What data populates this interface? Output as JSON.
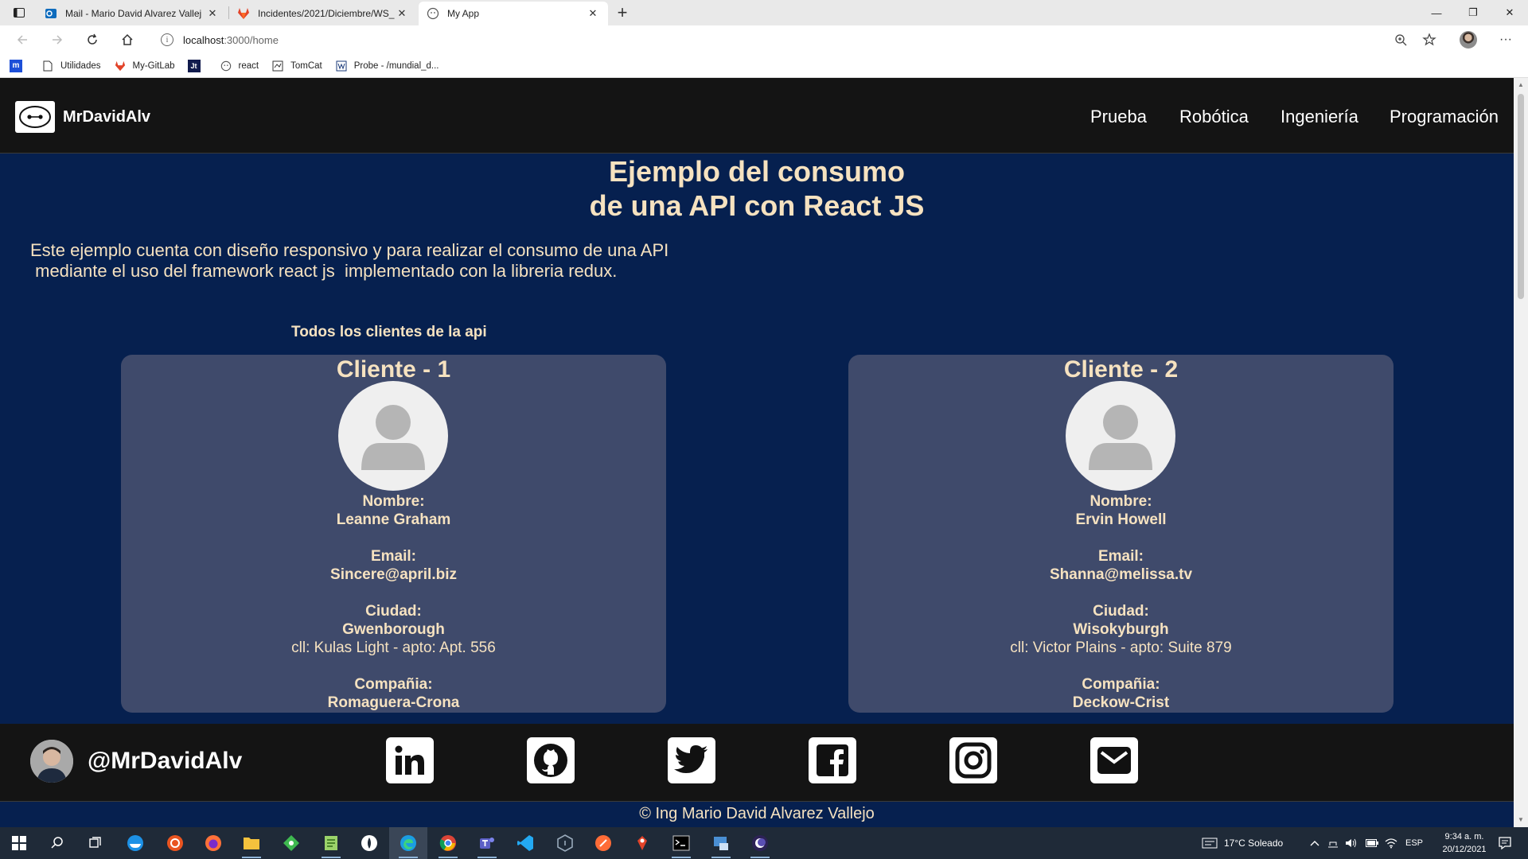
{
  "browser": {
    "tabs": [
      {
        "title": "Mail - Mario David Alvarez Vallej",
        "icon": "outlook-icon",
        "active": false
      },
      {
        "title": "Incidentes/2021/Diciembre/WS_",
        "icon": "gitlab-icon",
        "active": false
      },
      {
        "title": "My App",
        "icon": "react-face-icon",
        "active": true
      }
    ],
    "url_host": "localhost",
    "url_path": ":3000/home",
    "bookmarks": [
      {
        "label": "",
        "icon": "m-icon"
      },
      {
        "label": "Utilidades",
        "icon": "folder-page-icon"
      },
      {
        "label": "My-GitLab",
        "icon": "gitlab-icon"
      },
      {
        "label": "",
        "icon": "jt-icon"
      },
      {
        "label": "react",
        "icon": "react-face-icon"
      },
      {
        "label": "TomCat",
        "icon": "tomcat-icon"
      },
      {
        "label": "Probe - /mundial_d...",
        "icon": "probe-icon"
      }
    ]
  },
  "site": {
    "brand": "MrDavidAlv",
    "nav": [
      "Prueba",
      "Robótica",
      "Ingeniería",
      "Programación"
    ],
    "title_line1": "Ejemplo del consumo",
    "title_line2": "de una API con React JS",
    "description": "Este ejemplo cuenta con diseño responsivo y para realizar el consumo de una API\n mediante el uso del framework react js  implementado con la libreria redux.",
    "section_title": "Todos los clientes de la api",
    "labels": {
      "name": "Nombre:",
      "email": "Email:",
      "city": "Ciudad:",
      "company": "Compañia:"
    },
    "clients": [
      {
        "title": "Cliente - 1",
        "name": "Leanne Graham",
        "email": "Sincere@april.biz",
        "city": "Gwenborough",
        "address": "cll: Kulas Light - apto: Apt. 556",
        "company": "Romaguera-Crona"
      },
      {
        "title": "Cliente - 2",
        "name": "Ervin Howell",
        "email": "Shanna@melissa.tv",
        "city": "Wisokyburgh",
        "address": "cll: Victor Plains - apto: Suite 879",
        "company": "Deckow-Crist"
      }
    ],
    "footer_handle": "@MrDavidAlv",
    "social": [
      "linkedin-icon",
      "github-icon",
      "twitter-icon",
      "facebook-icon",
      "instagram-icon",
      "mail-icon"
    ],
    "copyright": "© Ing Mario David Alvarez Vallejo"
  },
  "taskbar": {
    "weather": "17°C  Soleado",
    "lang": "ESP",
    "time": "9:34 a. m.",
    "date": "20/12/2021"
  },
  "colors": {
    "page_bg": "#06204f",
    "nav_bg": "#141414",
    "card_bg": "#3f4a6b",
    "accent_text": "#f6e2c0"
  }
}
